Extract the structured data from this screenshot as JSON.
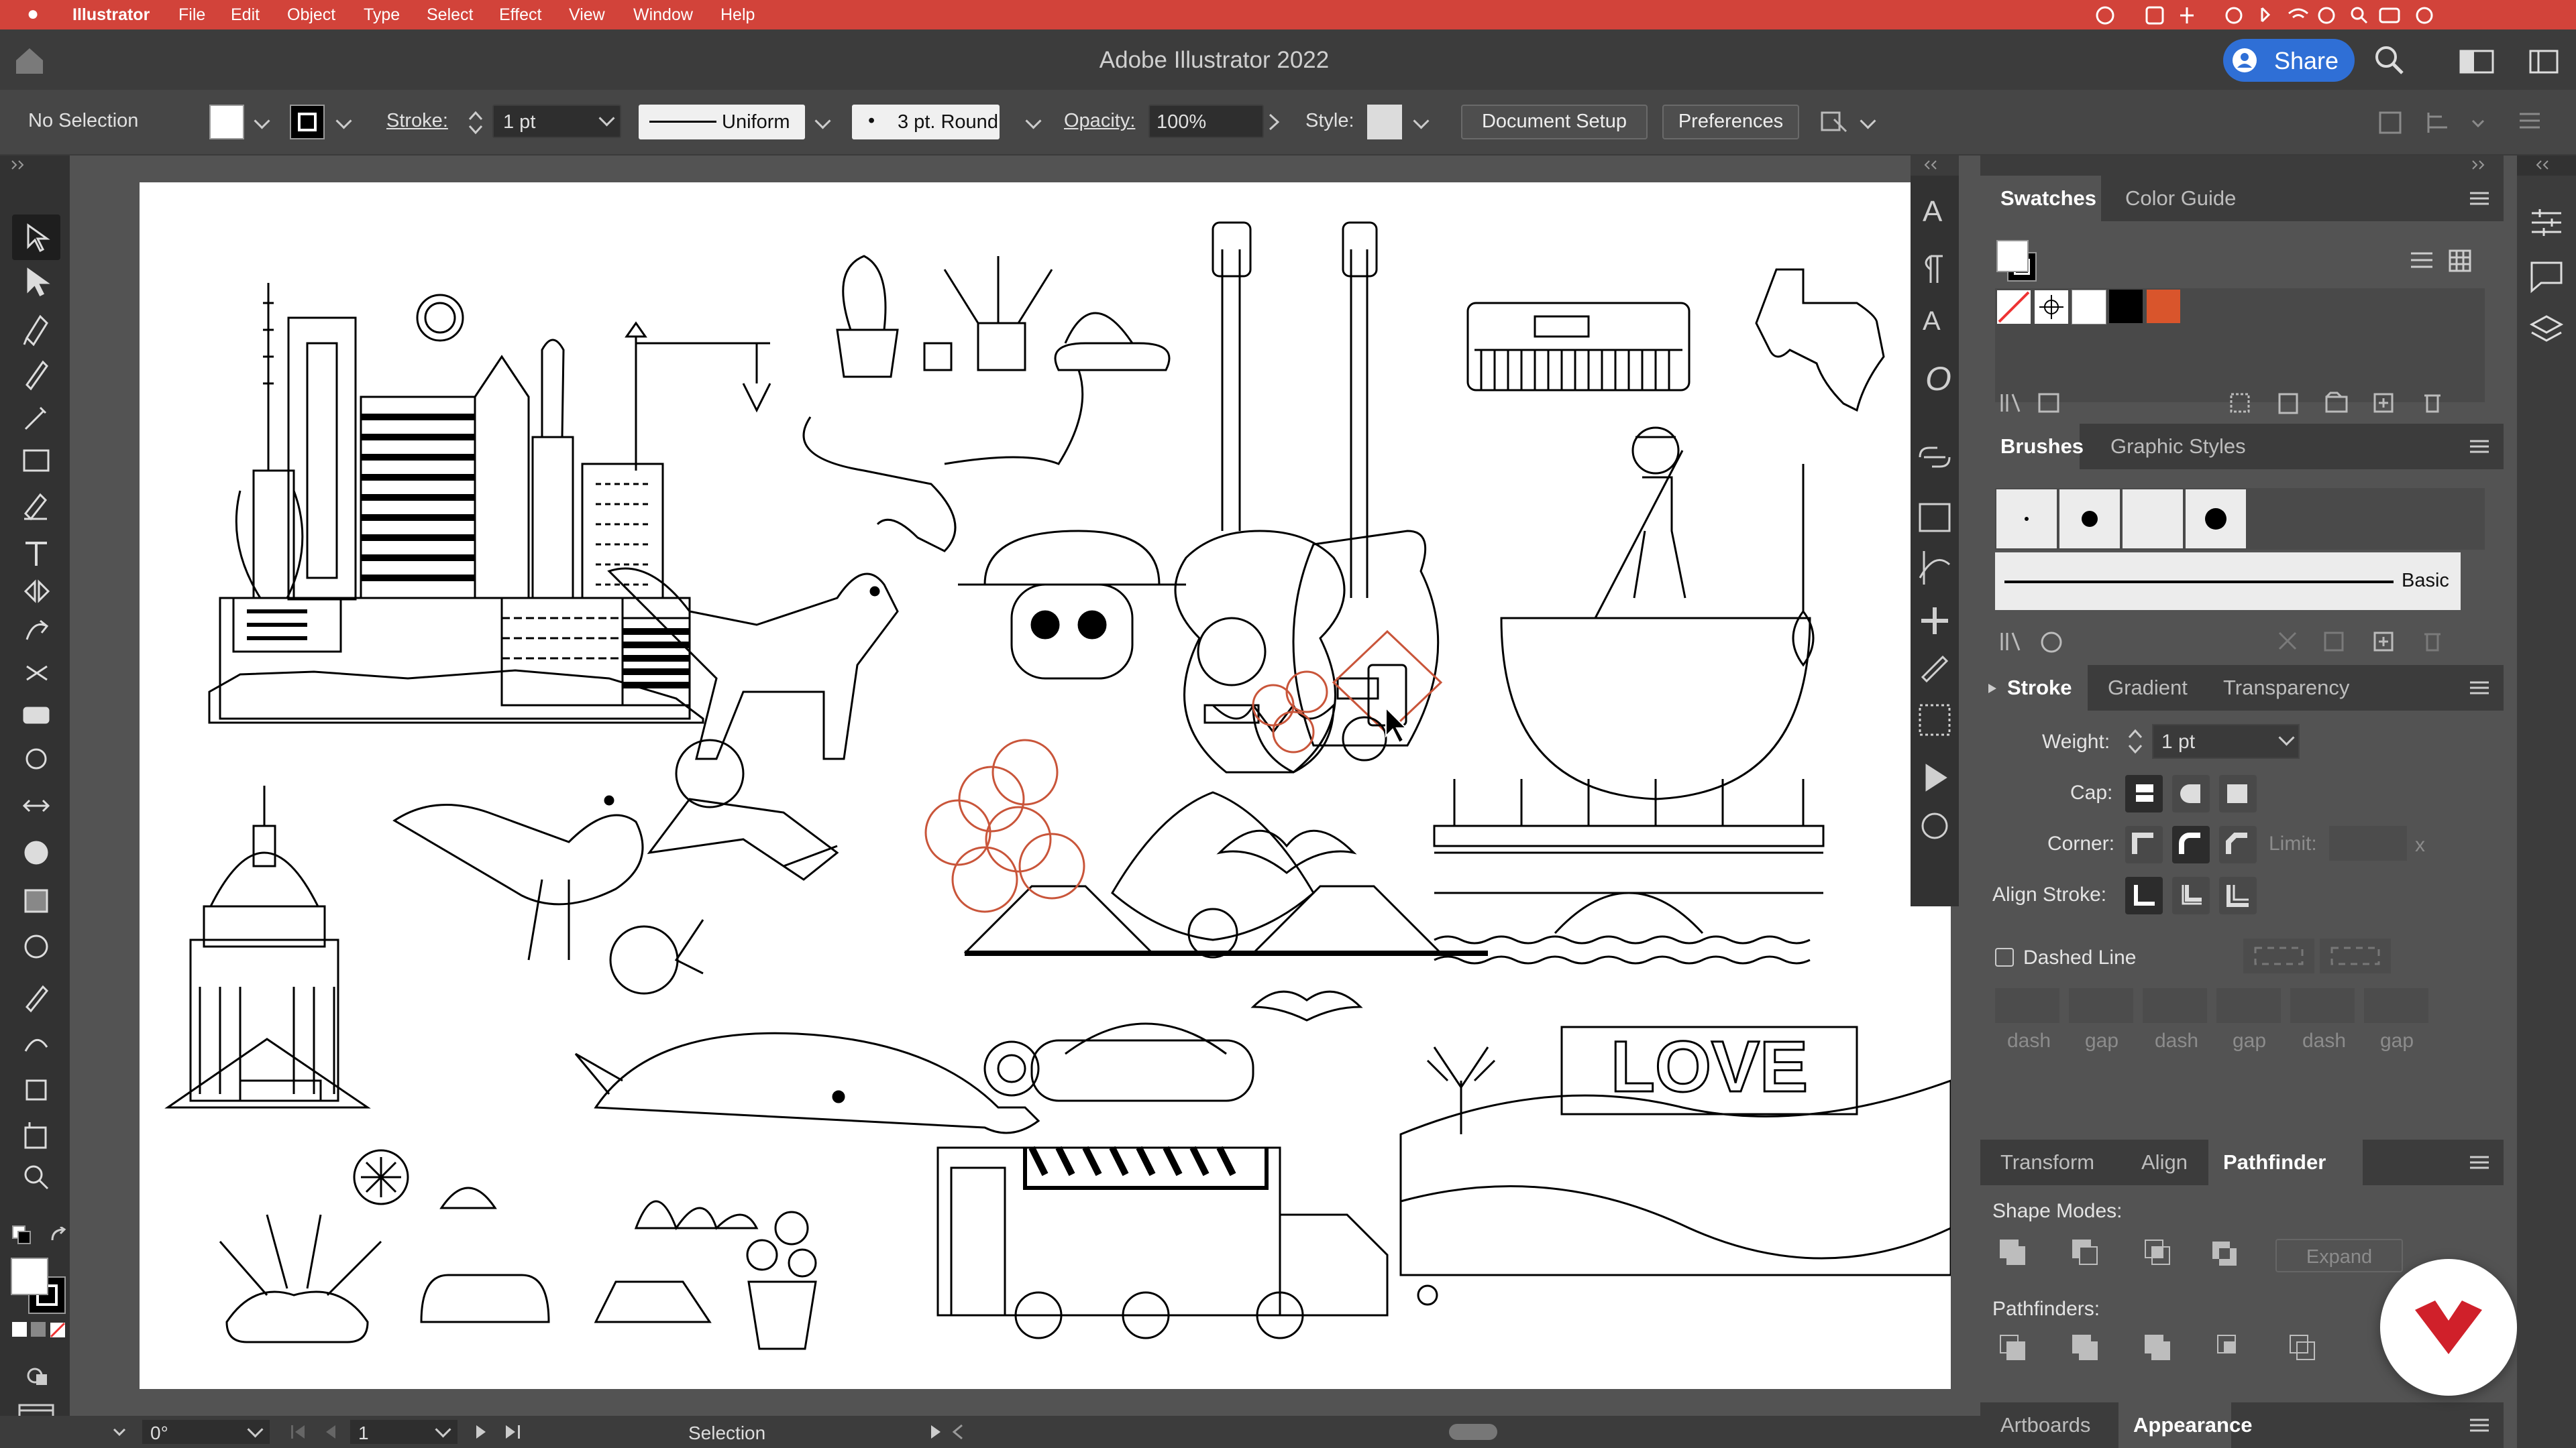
{
  "menubar": {
    "app_name": "Illustrator",
    "items": [
      "File",
      "Edit",
      "Object",
      "Type",
      "Select",
      "Effect",
      "View",
      "Window",
      "Help"
    ]
  },
  "titlebar": {
    "title": "Adobe Illustrator 2022",
    "share_label": "Share"
  },
  "control": {
    "selection_status": "No Selection",
    "stroke_label": "Stroke:",
    "stroke_value": "1 pt",
    "profile_label": "Uniform",
    "brush_label": "3 pt. Round",
    "opacity_label": "Opacity:",
    "opacity_value": "100%",
    "style_label": "Style:",
    "document_setup": "Document Setup",
    "preferences": "Preferences"
  },
  "panels": {
    "swatches_tab": "Swatches",
    "color_guide_tab": "Color Guide",
    "brushes_tab": "Brushes",
    "graphic_styles_tab": "Graphic Styles",
    "brush_basic": "Basic",
    "stroke_tab": "Stroke",
    "gradient_tab": "Gradient",
    "transparency_tab": "Transparency",
    "weight_label": "Weight:",
    "weight_value": "1 pt",
    "cap_label": "Cap:",
    "corner_label": "Corner:",
    "limit_label": "Limit:",
    "limit_x": "x",
    "align_stroke_label": "Align Stroke:",
    "dashed_line_label": "Dashed Line",
    "dash_labels": [
      "dash",
      "gap",
      "dash",
      "gap",
      "dash",
      "gap"
    ],
    "transform_tab": "Transform",
    "align_tab": "Align",
    "pathfinder_tab": "Pathfinder",
    "shape_modes_label": "Shape Modes:",
    "expand_label": "Expand",
    "pathfinders_label": "Pathfinders:",
    "artboards_tab": "Artboards",
    "appearance_tab": "Appearance"
  },
  "swatch_colors": [
    "#ffffff",
    "#ffffff",
    "#000000",
    "#d9552c"
  ],
  "colors": {
    "menubar_bg": "#d2433a",
    "share_bg": "#2f6fd6",
    "accent_orange": "#c9553a"
  },
  "status": {
    "rotation": "0°",
    "artboard_number": "1",
    "tool_name": "Selection"
  },
  "artwork": {
    "sign_text": "LOVE"
  }
}
